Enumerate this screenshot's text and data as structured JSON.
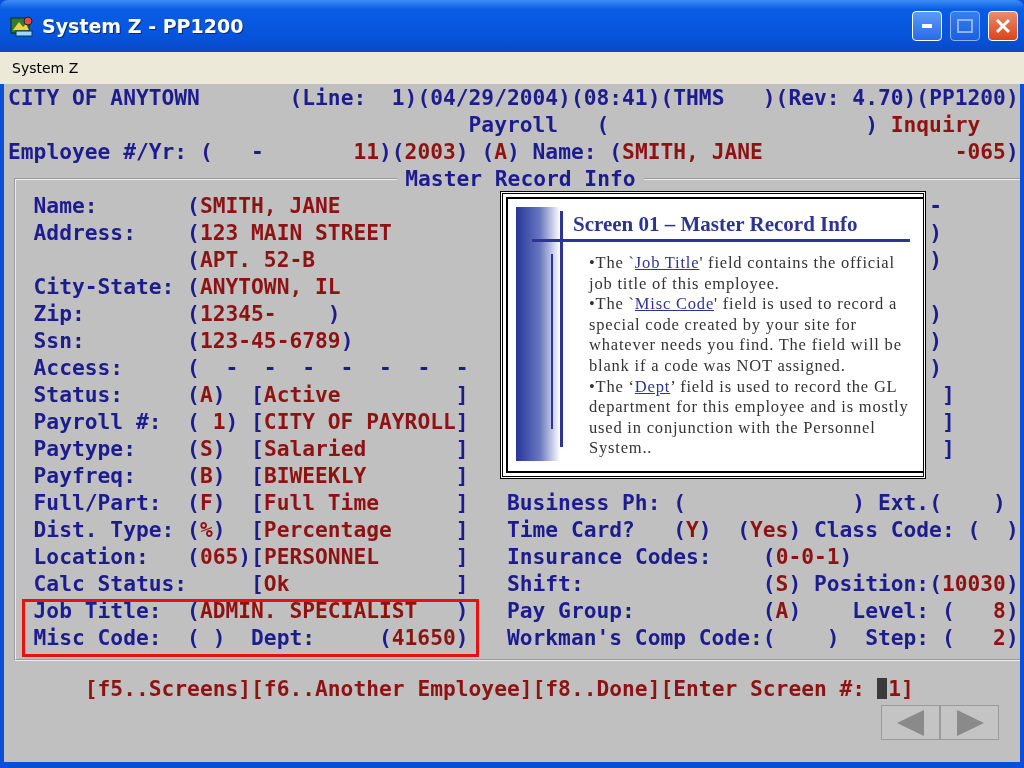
{
  "window": {
    "title": "System Z - PP1200"
  },
  "menu": [
    {
      "label": "System Z"
    }
  ],
  "header_lines": [
    [
      {
        "kind": "label",
        "text": "CITY OF ANYTOWN"
      },
      {
        "kind": "label",
        "text": "(Line:"
      },
      {
        "kind": "label",
        "text": "1)(04/29/2004)(08:41)(THMS"
      },
      {
        "kind": "label",
        "text": ")(Rev: 4.70)(PP1200)"
      }
    ],
    [
      {
        "kind": "label",
        "text": "Payroll"
      },
      {
        "kind": "label",
        "text": "("
      },
      {
        "kind": "label",
        "text": ")"
      },
      {
        "kind": "value",
        "text": "Inquiry"
      }
    ],
    [
      {
        "kind": "label",
        "text": "Employee #/Yr:"
      },
      {
        "kind": "label",
        "text": "("
      },
      {
        "kind": "label",
        "text": "-"
      },
      {
        "kind": "value",
        "text": "11)(2003) (A)"
      },
      {
        "kind": "label",
        "text": "Name:"
      },
      {
        "kind": "value",
        "text": "(SMITH, JANE"
      },
      {
        "kind": "value",
        "text": "-065)"
      }
    ]
  ],
  "record_box": {
    "title": "Master Record Info",
    "rows": [
      {
        "left": [
          {
            "kind": "label",
            "text": "Name:"
          },
          {
            "kind": "value",
            "text": "(SMITH, JANE"
          }
        ],
        "right": [
          {
            "kind": "label",
            "text": "-"
          }
        ]
      },
      {
        "left": [
          {
            "kind": "label",
            "text": "Address:"
          },
          {
            "kind": "value",
            "text": "(123 MAIN STREET"
          }
        ],
        "right": [
          {
            "kind": "label",
            "text": ")"
          }
        ]
      },
      {
        "left": [
          {
            "kind": "value",
            "text": "(APT. 52-B"
          }
        ],
        "right": [
          {
            "kind": "label",
            "text": ")"
          }
        ]
      },
      {
        "left": [
          {
            "kind": "label",
            "text": "City-State:"
          },
          {
            "kind": "value",
            "text": "(ANYTOWN, IL"
          }
        ],
        "right": []
      },
      {
        "left": [
          {
            "kind": "label",
            "text": "Zip:"
          },
          {
            "kind": "value",
            "text": "(12345-    )"
          }
        ],
        "right": [
          {
            "kind": "label",
            "text": ")"
          }
        ]
      },
      {
        "left": [
          {
            "kind": "label",
            "text": "Ssn:"
          },
          {
            "kind": "value",
            "text": "(123-45-6789)"
          }
        ],
        "right": [
          {
            "kind": "label",
            "text": ")"
          }
        ]
      },
      {
        "left": [
          {
            "kind": "label",
            "text": "Access:"
          },
          {
            "kind": "label",
            "text": "(  -  -  -  -  -  -  -"
          }
        ],
        "right": [
          {
            "kind": "label",
            "text": ")"
          }
        ]
      },
      {
        "left": [
          {
            "kind": "label",
            "text": "Status:"
          },
          {
            "kind": "value",
            "text": "(A)"
          },
          {
            "kind": "value",
            "text": "[Active"
          },
          {
            "kind": "value",
            "text": "]"
          }
        ],
        "right": [
          {
            "kind": "label",
            "text": "]"
          }
        ]
      },
      {
        "left": [
          {
            "kind": "label",
            "text": "Payroll #:"
          },
          {
            "kind": "value",
            "text": "( 1)"
          },
          {
            "kind": "value",
            "text": "[CITY OF PAYROLL]"
          }
        ],
        "right": [
          {
            "kind": "label",
            "text": "]"
          }
        ]
      },
      {
        "left": [
          {
            "kind": "label",
            "text": "Paytype:"
          },
          {
            "kind": "value",
            "text": "(S)"
          },
          {
            "kind": "value",
            "text": "[Salaried"
          },
          {
            "kind": "value",
            "text": "]"
          }
        ],
        "right": [
          {
            "kind": "label",
            "text": "]"
          }
        ]
      },
      {
        "left": [
          {
            "kind": "label",
            "text": "Payfreq:"
          },
          {
            "kind": "value",
            "text": "(B)"
          },
          {
            "kind": "value",
            "text": "[BIWEEKLY"
          },
          {
            "kind": "value",
            "text": "]"
          }
        ],
        "right": []
      },
      {
        "left": [
          {
            "kind": "label",
            "text": "Full/Part:"
          },
          {
            "kind": "value",
            "text": "(F)"
          },
          {
            "kind": "value",
            "text": "[Full Time"
          },
          {
            "kind": "value",
            "text": "]"
          }
        ],
        "right": [
          {
            "kind": "label",
            "text": "Business Ph:"
          },
          {
            "kind": "value",
            "text": "("
          },
          {
            "kind": "value",
            "text": ")"
          },
          {
            "kind": "label",
            "text": "Ext."
          },
          {
            "kind": "value",
            "text": "(    )"
          }
        ]
      },
      {
        "left": [
          {
            "kind": "label",
            "text": "Dist. Type:"
          },
          {
            "kind": "value",
            "text": "(%)"
          },
          {
            "kind": "value",
            "text": "[Percentage"
          },
          {
            "kind": "value",
            "text": "]"
          }
        ],
        "right": [
          {
            "kind": "label",
            "text": "Time Card?"
          },
          {
            "kind": "value",
            "text": "(Y)"
          },
          {
            "kind": "value",
            "text": "(Yes)"
          },
          {
            "kind": "label",
            "text": "Class Code:"
          },
          {
            "kind": "value",
            "text": "(  )"
          }
        ]
      },
      {
        "left": [
          {
            "kind": "label",
            "text": "Location:"
          },
          {
            "kind": "value",
            "text": "(065)[PERSONNEL"
          },
          {
            "kind": "value",
            "text": "]"
          }
        ],
        "right": [
          {
            "kind": "label",
            "text": "Insurance Codes:"
          },
          {
            "kind": "value",
            "text": "(0-0-1)"
          }
        ]
      },
      {
        "left": [
          {
            "kind": "label",
            "text": "Calc Status:"
          },
          {
            "kind": "value",
            "text": "[Ok"
          },
          {
            "kind": "value",
            "text": "]"
          }
        ],
        "right": [
          {
            "kind": "label",
            "text": "Shift:"
          },
          {
            "kind": "value",
            "text": "(S)"
          },
          {
            "kind": "label",
            "text": "Position:"
          },
          {
            "kind": "value",
            "text": "(10030)"
          }
        ]
      },
      {
        "left": [
          {
            "kind": "label",
            "text": "Job Title:"
          },
          {
            "kind": "value",
            "text": "(ADMIN. SPECIALIST"
          },
          {
            "kind": "value",
            "text": ")"
          }
        ],
        "right": [
          {
            "kind": "label",
            "text": "Pay Group:"
          },
          {
            "kind": "value",
            "text": "(A)"
          },
          {
            "kind": "label",
            "text": "Level:"
          },
          {
            "kind": "value",
            "text": "(   8)"
          }
        ]
      },
      {
        "left": [
          {
            "kind": "label",
            "text": "Misc Code:"
          },
          {
            "kind": "value",
            "text": "( )"
          },
          {
            "kind": "label",
            "text": "Dept:"
          },
          {
            "kind": "value",
            "text": "(41650)"
          }
        ],
        "right": [
          {
            "kind": "label",
            "text": "Workman's Comp Code:"
          },
          {
            "kind": "value",
            "text": "("
          },
          {
            "kind": "value",
            "text": ")"
          },
          {
            "kind": "label",
            "text": "Step:"
          },
          {
            "kind": "value",
            "text": "(   2)"
          }
        ]
      }
    ]
  },
  "footer": {
    "prompt": "[f5..Screens][f6..Another Employee][f8..Done][Enter Screen #:",
    "entry": "1]"
  },
  "callout": {
    "title": "Screen 01 – Master Record Info",
    "notes": [
      {
        "before": "•The `",
        "link": "Job Title",
        "after": "' field contains the official job title of this employee."
      },
      {
        "before": "•The `",
        "link": "Misc Code",
        "after": "' field is used to record a special code created by your site for whatever needs you find. The field will be blank if a code was NOT assigned."
      },
      {
        "before": "•The ‘",
        "link": "Dept",
        "after": "’ field is used to record the GL department for this employee and is mostly used in conjunction with the Personnel System.."
      }
    ]
  }
}
